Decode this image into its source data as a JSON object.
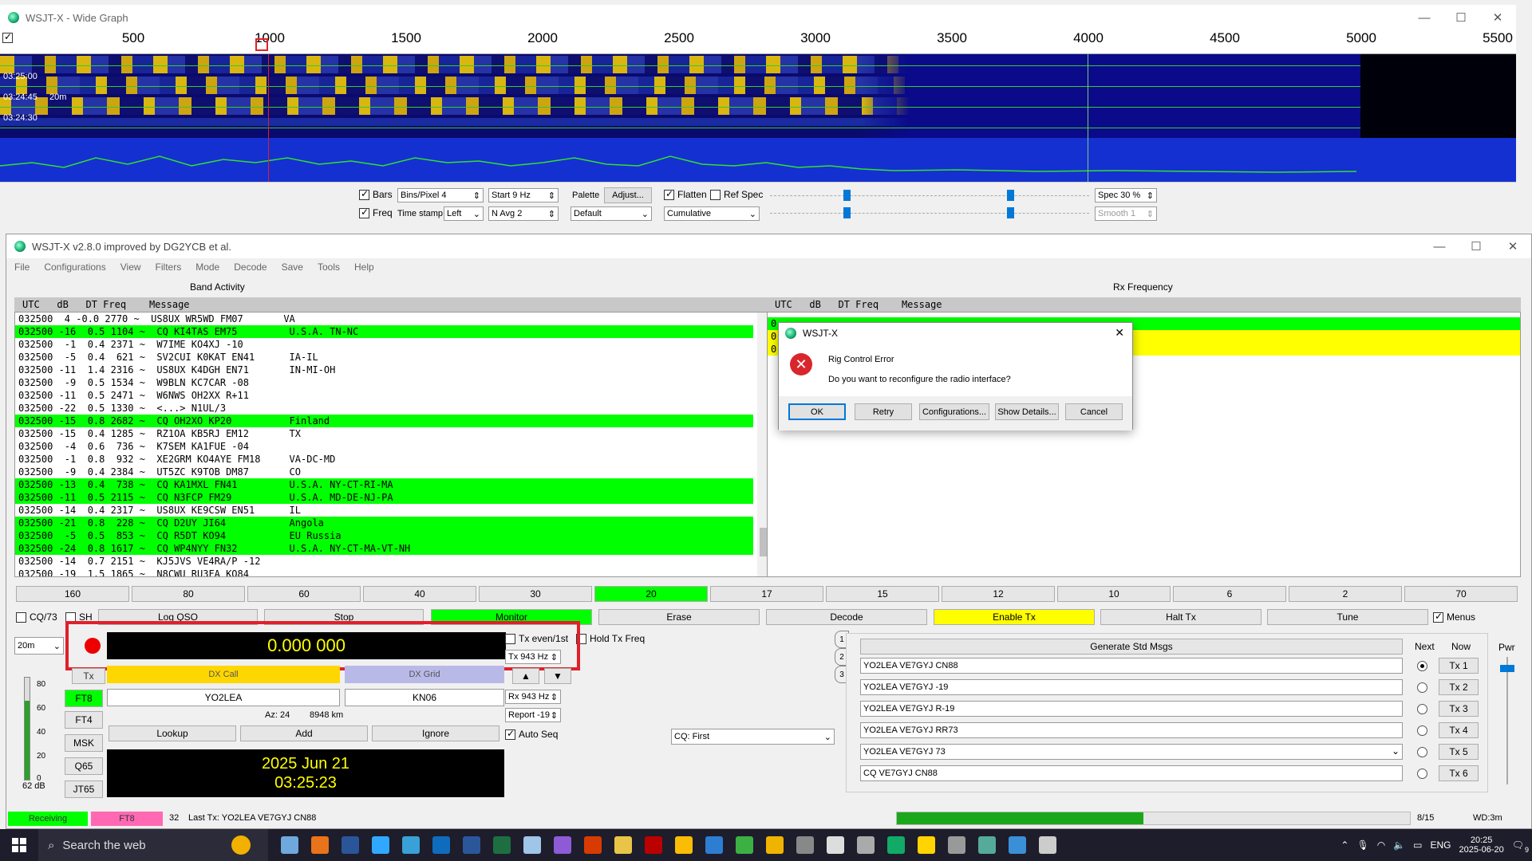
{
  "wide_graph": {
    "title": "WSJT-X - Wide Graph",
    "scale_ticks": [
      "500",
      "1000",
      "1500",
      "2000",
      "2500",
      "3000",
      "3500",
      "4000",
      "4500",
      "5000",
      "5500"
    ],
    "timestamps": [
      "03:25:00",
      "03:24:45",
      "03:24:30"
    ],
    "timestamp_suffix": "20m",
    "bars_label": "Bars",
    "freq_label": "Freq",
    "bins_per_pixel": "Bins/Pixel  4",
    "start": "Start 9 Hz",
    "time_stamp_label": "Time stamp",
    "time_stamp_value": "Left",
    "navg": "N Avg  2",
    "palette_label": "Palette",
    "adjust_button": "Adjust...",
    "palette_value": "Default",
    "flatten_label": "Flatten",
    "refspec_label": "Ref Spec",
    "cumulative_value": "Cumulative",
    "spec": "Spec 30 %",
    "smooth": "Smooth  1"
  },
  "main": {
    "title": "WSJT-X   v2.8.0   improved by DG2YCB et al.",
    "menu": [
      "File",
      "Configurations",
      "View",
      "Filters",
      "Mode",
      "Decode",
      "Save",
      "Tools",
      "Help"
    ],
    "band_activity_label": "Band Activity",
    "rx_frequency_label": "Rx Frequency",
    "list_header": "UTC   dB   DT Freq    Message",
    "band_activity": [
      {
        "t": "032500  4 -0.0 2770 ~  US8UX WR5WD FM07       VA",
        "g": false
      },
      {
        "t": "032500 -16  0.5 1104 ~  CQ KI4TAS EM75         U.S.A. TN-NC",
        "g": true
      },
      {
        "t": "032500  -1  0.4 2371 ~  W7IME KO4XJ -10",
        "g": false
      },
      {
        "t": "032500  -5  0.4  621 ~  SV2CUI K0KAT EN41      IA-IL",
        "g": false
      },
      {
        "t": "032500 -11  1.4 2316 ~  US8UX K4DGH EN71       IN-MI-OH",
        "g": false
      },
      {
        "t": "032500  -9  0.5 1534 ~  W9BLN KC7CAR -08",
        "g": false
      },
      {
        "t": "032500 -11  0.5 2471 ~  W6NWS OH2XX R+11",
        "g": false
      },
      {
        "t": "032500 -22  0.5 1330 ~  <...> N1UL/3",
        "g": false
      },
      {
        "t": "032500 -15  0.8 2682 ~  CQ OH2XO KP20          Finland",
        "g": true
      },
      {
        "t": "032500 -15  0.4 1285 ~  RZ1OA KB5RJ EM12       TX",
        "g": false
      },
      {
        "t": "032500  -4  0.6  736 ~  K7SEM KA1FUE -04",
        "g": false
      },
      {
        "t": "032500  -1  0.8  932 ~  XE2GRM KO4AYE FM18     VA-DC-MD",
        "g": false
      },
      {
        "t": "032500  -9  0.4 2384 ~  UT5ZC K9TOB DM87       CO",
        "g": false
      },
      {
        "t": "032500 -13  0.4  738 ~  CQ KA1MXL FN41         U.S.A. NY-CT-RI-MA",
        "g": true
      },
      {
        "t": "032500 -11  0.5 2115 ~  CQ N3FCP FM29          U.S.A. MD-DE-NJ-PA",
        "g": true
      },
      {
        "t": "032500 -14  0.4 2317 ~  US8UX KE9CSW EN51      IL",
        "g": false
      },
      {
        "t": "032500 -21  0.8  228 ~  CQ D2UY JI64           Angola",
        "g": true
      },
      {
        "t": "032500  -5  0.5  853 ~  CQ R5DT KO94           EU Russia",
        "g": true
      },
      {
        "t": "032500 -24  0.8 1617 ~  CQ WP4NYY FN32         U.S.A. NY-CT-MA-VT-NH",
        "g": true
      },
      {
        "t": "032500 -14  0.7 2151 ~  KJ5JVS VE4RA/P -12",
        "g": false
      },
      {
        "t": "032500 -19  1.5 1865 ~  N8CWU RU3FA KO84",
        "g": false
      }
    ],
    "rx_lines": [
      "0",
      "0",
      "0"
    ],
    "bands": [
      "160",
      "80",
      "60",
      "40",
      "30",
      "20",
      "17",
      "15",
      "12",
      "10",
      "6",
      "2",
      "70"
    ],
    "selected_band": "20",
    "row_buttons": {
      "cq73": "CQ/73",
      "sh": "SH",
      "log": "Log QSO",
      "stop": "Stop",
      "monitor": "Monitor",
      "erase": "Erase",
      "decode": "Decode",
      "enable_tx": "Enable Tx",
      "halt_tx": "Halt Tx",
      "tune": "Tune",
      "menus": "Menus"
    },
    "band_select": "20m",
    "freq_display": "0.000 000",
    "tx_even": "Tx even/1st",
    "hold_tx": "Hold Tx Freq",
    "tx_hz": "Tx  943 Hz",
    "rx_hz": "Rx  943 Hz",
    "report": "Report -19",
    "auto_seq": "Auto Seq",
    "dx_call_label": "DX Call",
    "dx_grid_label": "DX Grid",
    "dx_call": "YO2LEA",
    "dx_grid": "KN06",
    "az": "Az: 24",
    "dist": "8948 km",
    "lookup": "Lookup",
    "add": "Add",
    "ignore": "Ignore",
    "modes": [
      "FT8",
      "FT4",
      "MSK",
      "Q65",
      "JT65"
    ],
    "meter_ticks": [
      "80",
      "60",
      "40",
      "20",
      "0"
    ],
    "meter_value": "62 dB",
    "date": "2025 Jun 21",
    "time": "03:25:23",
    "cq_select": "CQ: First",
    "tabs": [
      "1",
      "2",
      "3"
    ],
    "gen_std": "Generate Std Msgs",
    "next_label": "Next",
    "now_label": "Now",
    "pwr_label": "Pwr",
    "tx_msgs": [
      {
        "msg": "YO2LEA VE7GYJ CN88",
        "btn": "Tx 1"
      },
      {
        "msg": "YO2LEA VE7GYJ -19",
        "btn": "Tx 2"
      },
      {
        "msg": "YO2LEA VE7GYJ R-19",
        "btn": "Tx 3"
      },
      {
        "msg": "YO2LEA VE7GYJ RR73",
        "btn": "Tx 4"
      },
      {
        "msg": "YO2LEA VE7GYJ 73",
        "btn": "Tx 5"
      },
      {
        "msg": "CQ VE7GYJ CN88",
        "btn": "Tx 6"
      }
    ],
    "status": {
      "receiving": "Receiving",
      "mode": "FT8",
      "count": "32",
      "last_tx": "Last Tx: YO2LEA VE7GYJ CN88",
      "progress": 0.48,
      "seq": "8/15",
      "wd": "WD:3m"
    }
  },
  "dialog": {
    "title": "WSJT-X",
    "heading": "Rig Control Error",
    "body": "Do you want to reconfigure the radio interface?",
    "buttons": [
      "OK",
      "Retry",
      "Configurations...",
      "Show Details...",
      "Cancel"
    ]
  },
  "taskbar": {
    "search_placeholder": "Search the web",
    "lang": "ENG",
    "time": "20:25",
    "date": "2025-06-20",
    "notif": "9"
  },
  "colors": {
    "green": "#00ff00",
    "yellow": "#ffff00",
    "red_highlight": "#e0202a"
  }
}
